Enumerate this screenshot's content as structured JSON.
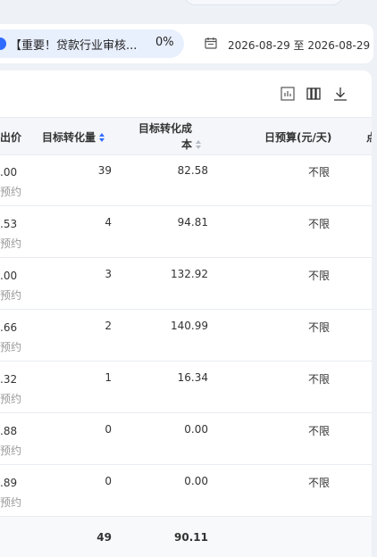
{
  "notice": {
    "text": "【重要！贷款行业审核...",
    "percent": "0%"
  },
  "date_range": "2026-08-29 至 2026-08-29",
  "icons": {
    "calendar": "calendar-icon",
    "chart": "chart-icon",
    "columns": "columns-icon",
    "download": "download-icon"
  },
  "table": {
    "headers": {
      "bid": "出价",
      "conversions": "目标转化量",
      "cost_line1": "目标转化成",
      "cost_line2": "本",
      "budget": "日预算(元/天)",
      "next": "点"
    },
    "rows": [
      {
        "bid": ".00",
        "bid_sub": "预约",
        "conversions": "39",
        "cost": "82.58",
        "budget": "不限"
      },
      {
        "bid": ".53",
        "bid_sub": "预约",
        "conversions": "4",
        "cost": "94.81",
        "budget": "不限"
      },
      {
        "bid": ".00",
        "bid_sub": "预约",
        "conversions": "3",
        "cost": "132.92",
        "budget": "不限"
      },
      {
        "bid": ".66",
        "bid_sub": "预约",
        "conversions": "2",
        "cost": "140.99",
        "budget": "不限"
      },
      {
        "bid": ".32",
        "bid_sub": "预约",
        "conversions": "1",
        "cost": "16.34",
        "budget": "不限"
      },
      {
        "bid": ".88",
        "bid_sub": "预约",
        "conversions": "0",
        "cost": "0.00",
        "budget": "不限"
      },
      {
        "bid": ".89",
        "bid_sub": "预约",
        "conversions": "0",
        "cost": "0.00",
        "budget": "不限"
      }
    ],
    "total": {
      "conversions": "49",
      "cost": "90.11"
    }
  },
  "colors": {
    "accent": "#2f6bff",
    "header_bg": "#f4f6fa",
    "page_bg": "#eef1f6"
  }
}
